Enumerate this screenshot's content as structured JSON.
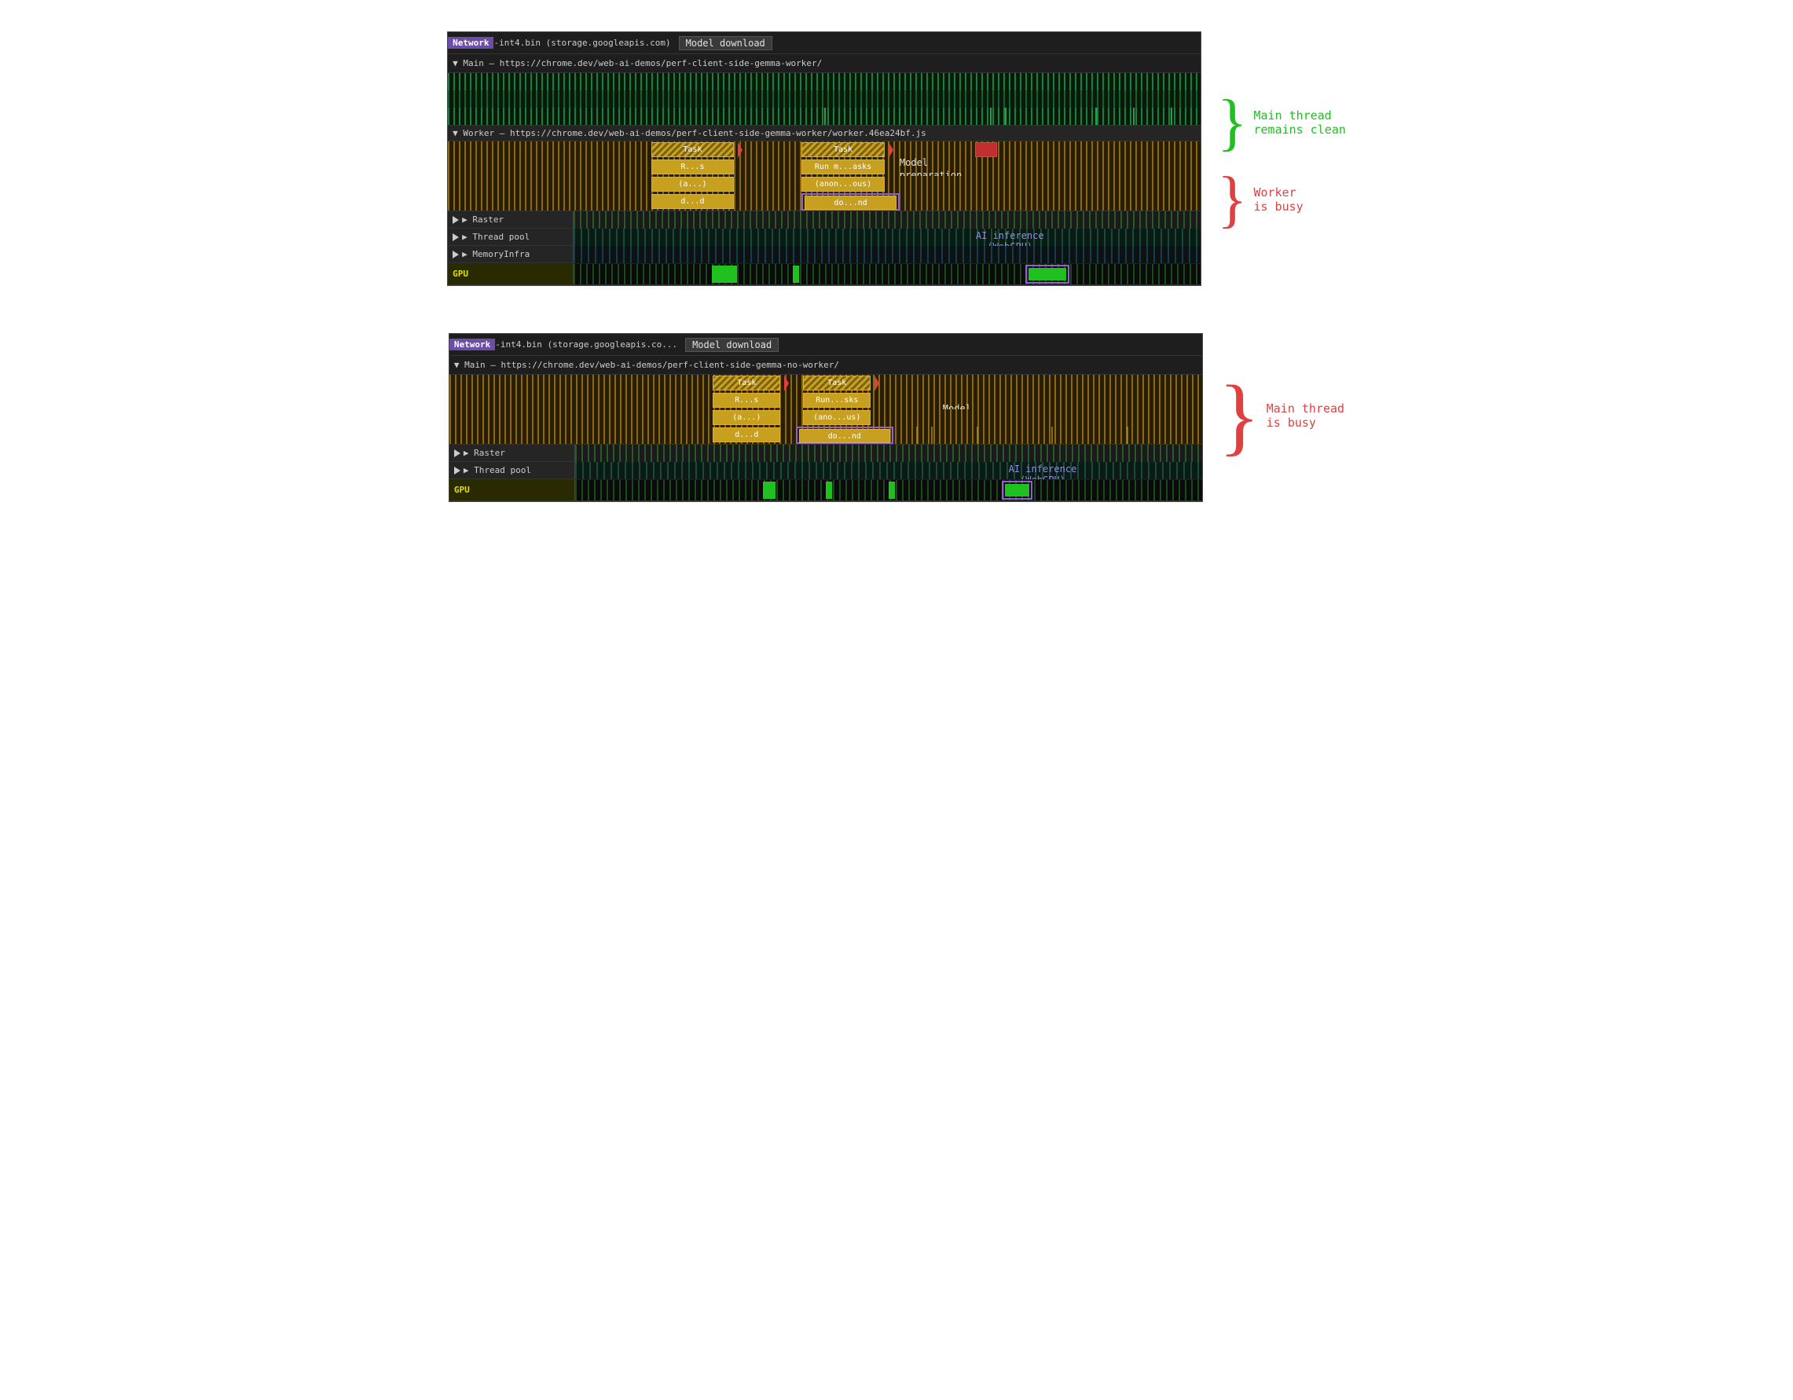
{
  "diagram1": {
    "network_row": {
      "badge": "Network",
      "file_text": "-int4.bin (storage.googleapis.com)",
      "model_download": "Model  download"
    },
    "main_row": {
      "label": "▼ Main — https://chrome.dev/web-ai-demos/perf-client-side-gemma-worker/"
    },
    "worker_row": {
      "label": "▼ Worker — https://chrome.dev/web-ai-demos/perf-client-side-gemma-worker/worker.46ea24bf.js"
    },
    "tasks": {
      "task1_label": "Task",
      "task2_label": "Task",
      "rs_label": "R...s",
      "a_label": "(a...)",
      "dd_label": "d...d",
      "run_masks_label": "Run m...asks",
      "anon_label": "(anon...ous)",
      "dond_label": "do...nd",
      "model_prep_label": "Model\npreparation"
    },
    "rows": {
      "raster_label": "▶ Raster",
      "thread_pool_label": "▶ Thread pool",
      "memory_infra_label": "▶ MemoryInfra",
      "gpu_label": "GPU"
    },
    "ai_inference_label": "AI inference\n(WebGPU)",
    "annotation_top": {
      "text": "Main thread\nremains clean",
      "color": "green"
    },
    "annotation_bottom": {
      "text": "Worker\nis busy",
      "color": "red"
    }
  },
  "diagram2": {
    "network_row": {
      "badge": "Network",
      "file_text": "-int4.bin (storage.googleapis.co...",
      "model_download": "Model  download"
    },
    "main_row": {
      "label": "▼ Main — https://chrome.dev/web-ai-demos/perf-client-side-gemma-no-worker/"
    },
    "tasks": {
      "task1_label": "Task",
      "task2_label": "Task",
      "rs_label": "R...s",
      "a_label": "(a...)",
      "dd_label": "d...d",
      "run_sks_label": "Run...sks",
      "anous_label": "(ano...us)",
      "dond_label": "do...nd",
      "model_prep_label": "Model\npreparation"
    },
    "rows": {
      "raster_label": "▶ Raster",
      "thread_pool_label": "▶ Thread pool",
      "gpu_label": "GPU"
    },
    "ai_inference_label": "AI inference\n(WebGPU)",
    "annotation": {
      "text": "Main thread\nis busy",
      "color": "red"
    }
  }
}
